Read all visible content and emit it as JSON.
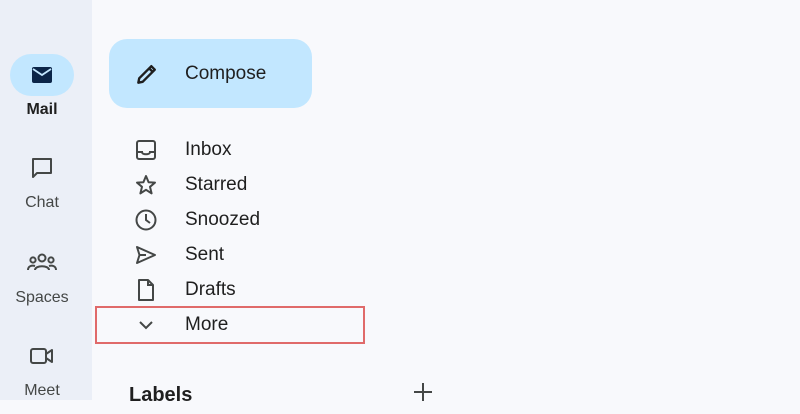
{
  "rail": {
    "items": [
      {
        "label": "Mail",
        "icon": "mail-icon",
        "active": true
      },
      {
        "label": "Chat",
        "icon": "chat-icon"
      },
      {
        "label": "Spaces",
        "icon": "spaces-icon"
      },
      {
        "label": "Meet",
        "icon": "meet-icon"
      }
    ]
  },
  "compose": {
    "label": "Compose",
    "icon": "pencil-icon"
  },
  "nav": {
    "items": [
      {
        "label": "Inbox",
        "icon": "inbox-icon"
      },
      {
        "label": "Starred",
        "icon": "star-icon"
      },
      {
        "label": "Snoozed",
        "icon": "clock-icon"
      },
      {
        "label": "Sent",
        "icon": "send-icon"
      },
      {
        "label": "Drafts",
        "icon": "draft-icon"
      },
      {
        "label": "More",
        "icon": "chevron-down-icon",
        "highlighted": true
      }
    ]
  },
  "labels": {
    "title": "Labels",
    "add_icon": "plus-icon"
  },
  "colors": {
    "rail_bg": "#ebeff7",
    "page_bg": "#f8f9fc",
    "active_pill": "#c2e7ff",
    "compose_bg": "#c2e7ff",
    "highlight_outline": "#e06a6a",
    "mail_icon": "#0b2548"
  }
}
